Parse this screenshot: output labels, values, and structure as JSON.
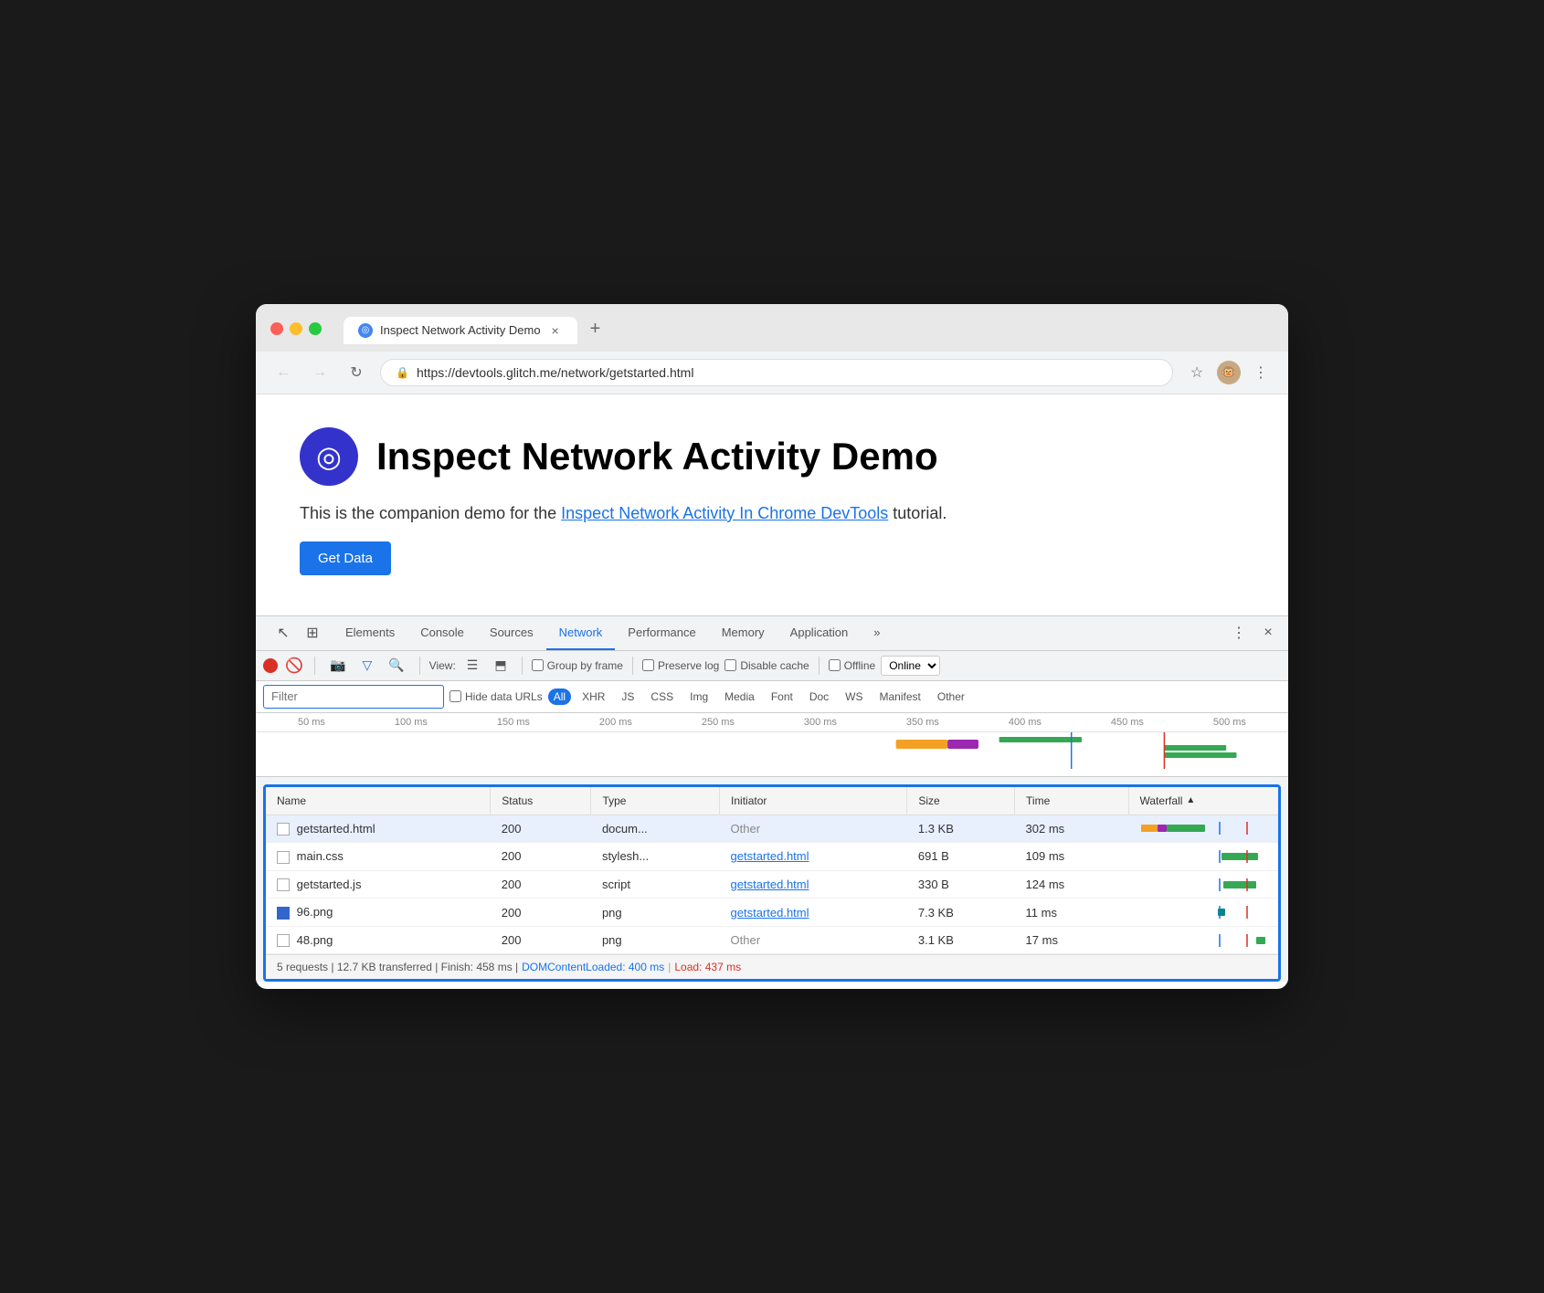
{
  "browser": {
    "controls": {
      "close": "close",
      "minimize": "minimize",
      "maximize": "maximize"
    },
    "tab": {
      "label": "Inspect Network Activity Demo",
      "icon": "🔵",
      "close": "×"
    },
    "tab_new": "+",
    "nav": {
      "back": "←",
      "forward": "→",
      "reload": "↻"
    },
    "address": {
      "lock": "🔒",
      "url_base": "https://devtools.glitch.me",
      "url_path": "/network/getstarted.html",
      "full_url": "https://devtools.glitch.me/network/getstarted.html"
    },
    "actions": {
      "bookmark": "☆",
      "more": "⋮"
    }
  },
  "page": {
    "icon": "◎",
    "title": "Inspect Network Activity Demo",
    "description_before": "This is the companion demo for the ",
    "description_link": "Inspect Network Activity In Chrome DevTools",
    "description_after": " tutorial.",
    "get_data_btn": "Get Data"
  },
  "devtools": {
    "tabs": [
      {
        "label": "Elements",
        "active": false
      },
      {
        "label": "Console",
        "active": false
      },
      {
        "label": "Sources",
        "active": false
      },
      {
        "label": "Network",
        "active": true
      },
      {
        "label": "Performance",
        "active": false
      },
      {
        "label": "Memory",
        "active": false
      },
      {
        "label": "Application",
        "active": false
      },
      {
        "label": "»",
        "active": false
      }
    ],
    "toolbar_icons": {
      "cursor": "↖",
      "layers": "⊞",
      "more_vert": "⋮",
      "close": "×"
    },
    "network_toolbar": {
      "record_btn": "record",
      "clear": "🚫",
      "camera": "📷",
      "filter_icon": "▽",
      "search_icon": "🔍",
      "view_label": "View:",
      "list_view": "☰",
      "waterfall_view": "⬒",
      "group_by_frame": "Group by frame",
      "preserve_log": "Preserve log",
      "disable_cache": "Disable cache",
      "offline": "Offline",
      "online_label": "Online",
      "online_dropdown": "▾"
    },
    "filter_bar": {
      "placeholder": "Filter",
      "hide_data_urls": "Hide data URLs",
      "all_badge": "All",
      "tags": [
        "XHR",
        "JS",
        "CSS",
        "Img",
        "Media",
        "Font",
        "Doc",
        "WS",
        "Manifest",
        "Other"
      ]
    },
    "timeline": {
      "ticks": [
        "50 ms",
        "100 ms",
        "150 ms",
        "200 ms",
        "250 ms",
        "300 ms",
        "350 ms",
        "400 ms",
        "450 ms",
        "500 ms"
      ]
    },
    "table": {
      "headers": [
        "Name",
        "Status",
        "Type",
        "Initiator",
        "Size",
        "Time",
        "Waterfall"
      ],
      "rows": [
        {
          "name": "getstarted.html",
          "status": "200",
          "type": "docum...",
          "initiator": "Other",
          "initiator_link": false,
          "size": "1.3 KB",
          "time": "302 ms",
          "waterfall": "combined",
          "selected": true,
          "icon": "default"
        },
        {
          "name": "main.css",
          "status": "200",
          "type": "stylesh...",
          "initiator": "getstarted.html",
          "initiator_link": true,
          "size": "691 B",
          "time": "109 ms",
          "waterfall": "green-right",
          "selected": false,
          "icon": "default"
        },
        {
          "name": "getstarted.js",
          "status": "200",
          "type": "script",
          "initiator": "getstarted.html",
          "initiator_link": true,
          "size": "330 B",
          "time": "124 ms",
          "waterfall": "green-right",
          "selected": false,
          "icon": "default"
        },
        {
          "name": "96.png",
          "status": "200",
          "type": "png",
          "initiator": "getstarted.html",
          "initiator_link": true,
          "size": "7.3 KB",
          "time": "11 ms",
          "waterfall": "teal-right",
          "selected": false,
          "icon": "blue"
        },
        {
          "name": "48.png",
          "status": "200",
          "type": "png",
          "initiator": "Other",
          "initiator_link": false,
          "size": "3.1 KB",
          "time": "17 ms",
          "waterfall": "green-far-right",
          "selected": false,
          "icon": "default"
        }
      ]
    },
    "status_bar": {
      "text": "5 requests | 12.7 KB transferred | Finish: 458 ms | ",
      "dom_loaded_label": "DOMContentLoaded: 400 ms",
      "separator": " | ",
      "load_label": "Load: 437 ms"
    }
  }
}
